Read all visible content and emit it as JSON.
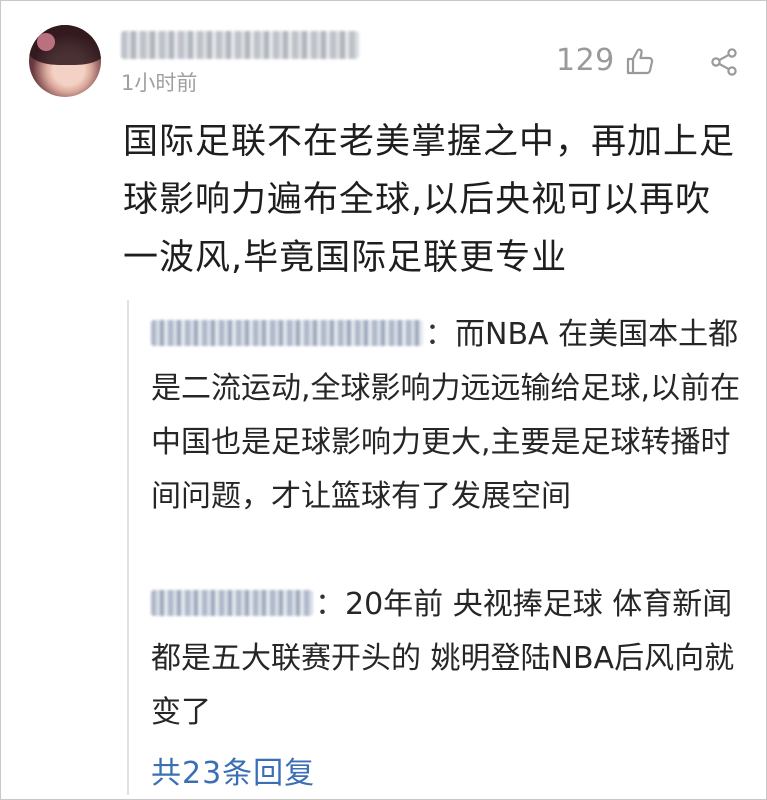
{
  "comment": {
    "timestamp": "1小时前",
    "like_count": "129",
    "text": "国际足联不在老美掌握之中，再加上足球影响力遍布全球,以后央视可以再吹一波风,毕竟国际足联更专业"
  },
  "replies": [
    {
      "separator": "：",
      "text": "而NBA 在美国本土都是二流运动,全球影响力远远输给足球,以前在中国也是足球影响力更大,主要是足球转播时间问题，才让篮球有了发展空间"
    },
    {
      "separator": "：",
      "text": "20年前 央视捧足球 体育新闻都是五大联赛开头的 姚明登陆NBA后风向就变了"
    }
  ],
  "more_replies_label": "共23条回复",
  "icons": {
    "like": "thumbs-up-icon",
    "share": "share-icon"
  },
  "colors": {
    "link": "#3b6fb5",
    "muted": "#9a9a9a"
  }
}
